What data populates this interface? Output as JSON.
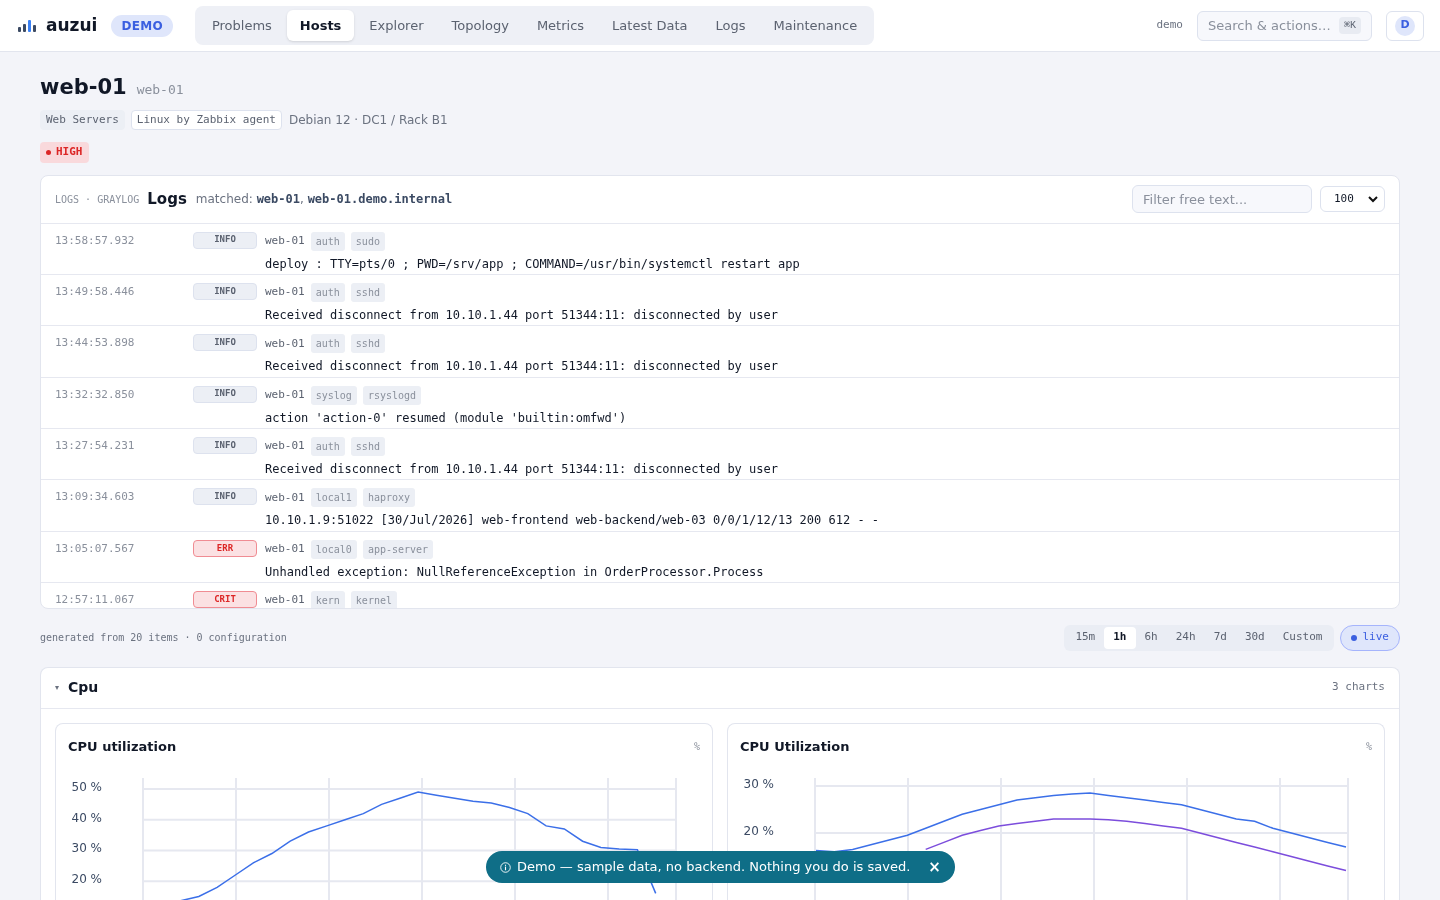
{
  "header": {
    "logo": "auzui",
    "badge": "DEMO",
    "nav": [
      {
        "label": "Problems",
        "selected": false
      },
      {
        "label": "Hosts",
        "selected": true
      },
      {
        "label": "Explorer",
        "selected": false
      },
      {
        "label": "Topology",
        "selected": false
      },
      {
        "label": "Metrics",
        "selected": false
      },
      {
        "label": "Latest Data",
        "selected": false
      },
      {
        "label": "Logs",
        "selected": false
      },
      {
        "label": "Maintenance",
        "selected": false
      }
    ],
    "user": "demo",
    "search_placeholder": "Search & actions…",
    "shortcut": "⌘K",
    "avatar": "D"
  },
  "host": {
    "name": "web-01",
    "alias": "web-01",
    "tags": [
      {
        "label": "Web Servers",
        "kind": "filled"
      },
      {
        "label": "Linux by Zabbix agent",
        "kind": "outlined"
      }
    ],
    "info": "Debian 12 · DC1 / Rack B1",
    "severity": "HIGH"
  },
  "logs": {
    "source": "LOGS · GRAYLOG",
    "title": "Logs",
    "matched": "matched: **web-01**, **web-01.demo.internal**",
    "filter_placeholder": "Filter free text...",
    "limit": "100",
    "entries": [
      {
        "time": "13:58:57.932",
        "level": "INFO",
        "kind": "info",
        "host": "web-01",
        "tags": [
          "auth",
          "sudo"
        ],
        "message": "deploy : TTY=pts/0 ; PWD=/srv/app ; COMMAND=/usr/bin/systemctl restart app"
      },
      {
        "time": "13:49:58.446",
        "level": "INFO",
        "kind": "info",
        "host": "web-01",
        "tags": [
          "auth",
          "sshd"
        ],
        "message": "Received disconnect from 10.10.1.44 port 51344:11: disconnected by user"
      },
      {
        "time": "13:44:53.898",
        "level": "INFO",
        "kind": "info",
        "host": "web-01",
        "tags": [
          "auth",
          "sshd"
        ],
        "message": "Received disconnect from 10.10.1.44 port 51344:11: disconnected by user"
      },
      {
        "time": "13:32:32.850",
        "level": "INFO",
        "kind": "info",
        "host": "web-01",
        "tags": [
          "syslog",
          "rsyslogd"
        ],
        "message": "action 'action-0' resumed (module 'builtin:omfwd')"
      },
      {
        "time": "13:27:54.231",
        "level": "INFO",
        "kind": "info",
        "host": "web-01",
        "tags": [
          "auth",
          "sshd"
        ],
        "message": "Received disconnect from 10.10.1.44 port 51344:11: disconnected by user"
      },
      {
        "time": "13:09:34.603",
        "level": "INFO",
        "kind": "info",
        "host": "web-01",
        "tags": [
          "local1",
          "haproxy"
        ],
        "message": "10.10.1.9:51022 [30/Jul/2026] web-frontend web-backend/web-03 0/0/1/12/13 200 612 - -"
      },
      {
        "time": "13:05:07.567",
        "level": "ERR",
        "kind": "error",
        "host": "web-01",
        "tags": [
          "local0",
          "app-server"
        ],
        "message": "Unhandled exception: NullReferenceException in OrderProcessor.Process"
      },
      {
        "time": "12:57:11.067",
        "level": "CRIT",
        "kind": "critical",
        "host": "web-01",
        "tags": [
          "kern",
          "kernel"
        ]
      }
    ]
  },
  "footer": {
    "note": "generated from 20 items · 0 configuration",
    "ranges": [
      {
        "label": "15m",
        "selected": false
      },
      {
        "label": "1h",
        "selected": true
      },
      {
        "label": "6h",
        "selected": false
      },
      {
        "label": "24h",
        "selected": false
      },
      {
        "label": "7d",
        "selected": false
      },
      {
        "label": "30d",
        "selected": false
      },
      {
        "label": "Custom",
        "selected": false
      }
    ],
    "live": "live"
  },
  "section": {
    "caret": "▾",
    "expanded": true,
    "title": "Cpu",
    "count": "3 charts",
    "charts": [
      {
        "title": "CPU utilization",
        "unit": "%",
        "chart_data": {
          "type": "line",
          "grid": true,
          "ylim": [
            13,
            53.6
          ],
          "yticks": [
            {
              "value": 50,
              "label": "50 %"
            },
            {
              "value": 40,
              "label": "40 %"
            },
            {
              "value": 30,
              "label": "30 %"
            },
            {
              "value": 20,
              "label": "20 %"
            }
          ],
          "series": [
            {
              "color": "#3b6fe8",
              "values": [
                null,
                null,
                13.6,
                15,
                18,
                22,
                26,
                29,
                33,
                36,
                38,
                40,
                42,
                45,
                47,
                49,
                48,
                47,
                46,
                45.5,
                44,
                42,
                38,
                37,
                33,
                31,
                30.5,
                30.2,
                16,
                null
              ]
            }
          ]
        }
      },
      {
        "title": "CPU Utilization",
        "unit": "%",
        "chart_data": {
          "type": "line",
          "grid": true,
          "ylim": [
            5.1,
            31.7
          ],
          "yticks": [
            {
              "value": 30,
              "label": "30 %"
            },
            {
              "value": 20,
              "label": "20 %"
            }
          ],
          "series": [
            {
              "color": "#3b6fe8",
              "values": [
                16.3,
                16,
                16.5,
                17.5,
                18.5,
                19.5,
                21,
                22.5,
                24,
                25,
                26,
                27,
                27.5,
                28,
                28.3,
                28.5,
                28,
                27.5,
                27,
                26.5,
                26,
                25,
                24,
                23,
                22.5,
                21,
                20,
                19,
                18,
                17
              ]
            },
            {
              "color": "#7c4ddc",
              "values": [
                null,
                null,
                null,
                null,
                null,
                null,
                16.5,
                18,
                19.5,
                20.5,
                21.5,
                22,
                22.5,
                23,
                23,
                23,
                22.8,
                22.5,
                22,
                21.5,
                21,
                20,
                19,
                18,
                17,
                16,
                15,
                14,
                13,
                12
              ]
            }
          ]
        }
      }
    ]
  },
  "toast": {
    "text": "Demo — sample data, no backend. Nothing you do is saved.",
    "close": "×"
  }
}
